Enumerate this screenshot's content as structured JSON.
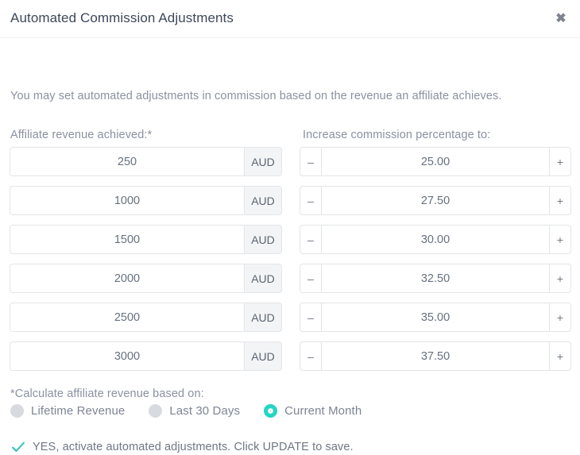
{
  "modal": {
    "title": "Automated Commission Adjustments",
    "close_icon": "close-icon",
    "intro": "You may set automated adjustments in commission based on the revenue an affiliate achieves.",
    "accent_color": "#25d5c4",
    "text_color": "#8a91a0",
    "title_color": "#3c4858"
  },
  "columns": {
    "left_label": "Affiliate revenue achieved:*",
    "right_label": "Increase commission percentage to:"
  },
  "stepper": {
    "decrement_label": "–",
    "increment_label": "+"
  },
  "tiers": [
    {
      "revenue": "250",
      "currency": "AUD",
      "percentage": "25.00"
    },
    {
      "revenue": "1000",
      "currency": "AUD",
      "percentage": "27.50"
    },
    {
      "revenue": "1500",
      "currency": "AUD",
      "percentage": "30.00"
    },
    {
      "revenue": "2000",
      "currency": "AUD",
      "percentage": "32.50"
    },
    {
      "revenue": "2500",
      "currency": "AUD",
      "percentage": "35.00"
    },
    {
      "revenue": "3000",
      "currency": "AUD",
      "percentage": "37.50"
    }
  ],
  "calculation": {
    "label": "*Calculate affiliate revenue based on:",
    "options": [
      {
        "label": "Lifetime Revenue",
        "selected": false
      },
      {
        "label": "Last 30 Days",
        "selected": false
      },
      {
        "label": "Current Month",
        "selected": true
      }
    ]
  },
  "confirm": {
    "icon": "check-icon",
    "text": "YES, activate automated adjustments. Click UPDATE to save."
  }
}
